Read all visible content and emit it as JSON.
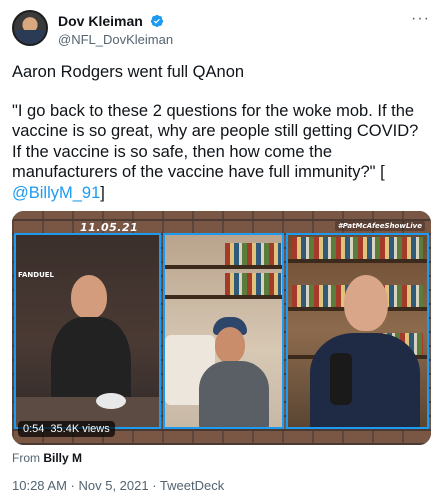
{
  "author": {
    "display_name": "Dov Kleiman",
    "handle": "@NFL_DovKleiman",
    "verified_icon": "verified-badge-icon",
    "avatar_icon": "avatar"
  },
  "more_icon": "more-options-icon",
  "more_glyph": "···",
  "tweet": {
    "line1": "Aaron Rodgers went full QAnon",
    "line2": "\"I go back to these 2 questions for the woke mob. If the vaccine is so great, why are people still getting COVID? If the vaccine is so safe, then how come the manufacturers of the vaccine have full immunity?\" [",
    "mention": "@BillyM_91",
    "line2_end": "]"
  },
  "video": {
    "date_overlay": "11.05.21",
    "tag_overlay": "#PatMcAfeeShowLive",
    "sponsor_overlay": "FANDUEL",
    "time": "0:54",
    "views": "35.4K views"
  },
  "from": {
    "prefix": "From",
    "name": "Billy M"
  },
  "meta": "10:28 AM · Nov 5, 2021 · TweetDeck",
  "colors": {
    "link": "#1d9bf0",
    "secondary": "#536471",
    "text": "#0f1419"
  }
}
